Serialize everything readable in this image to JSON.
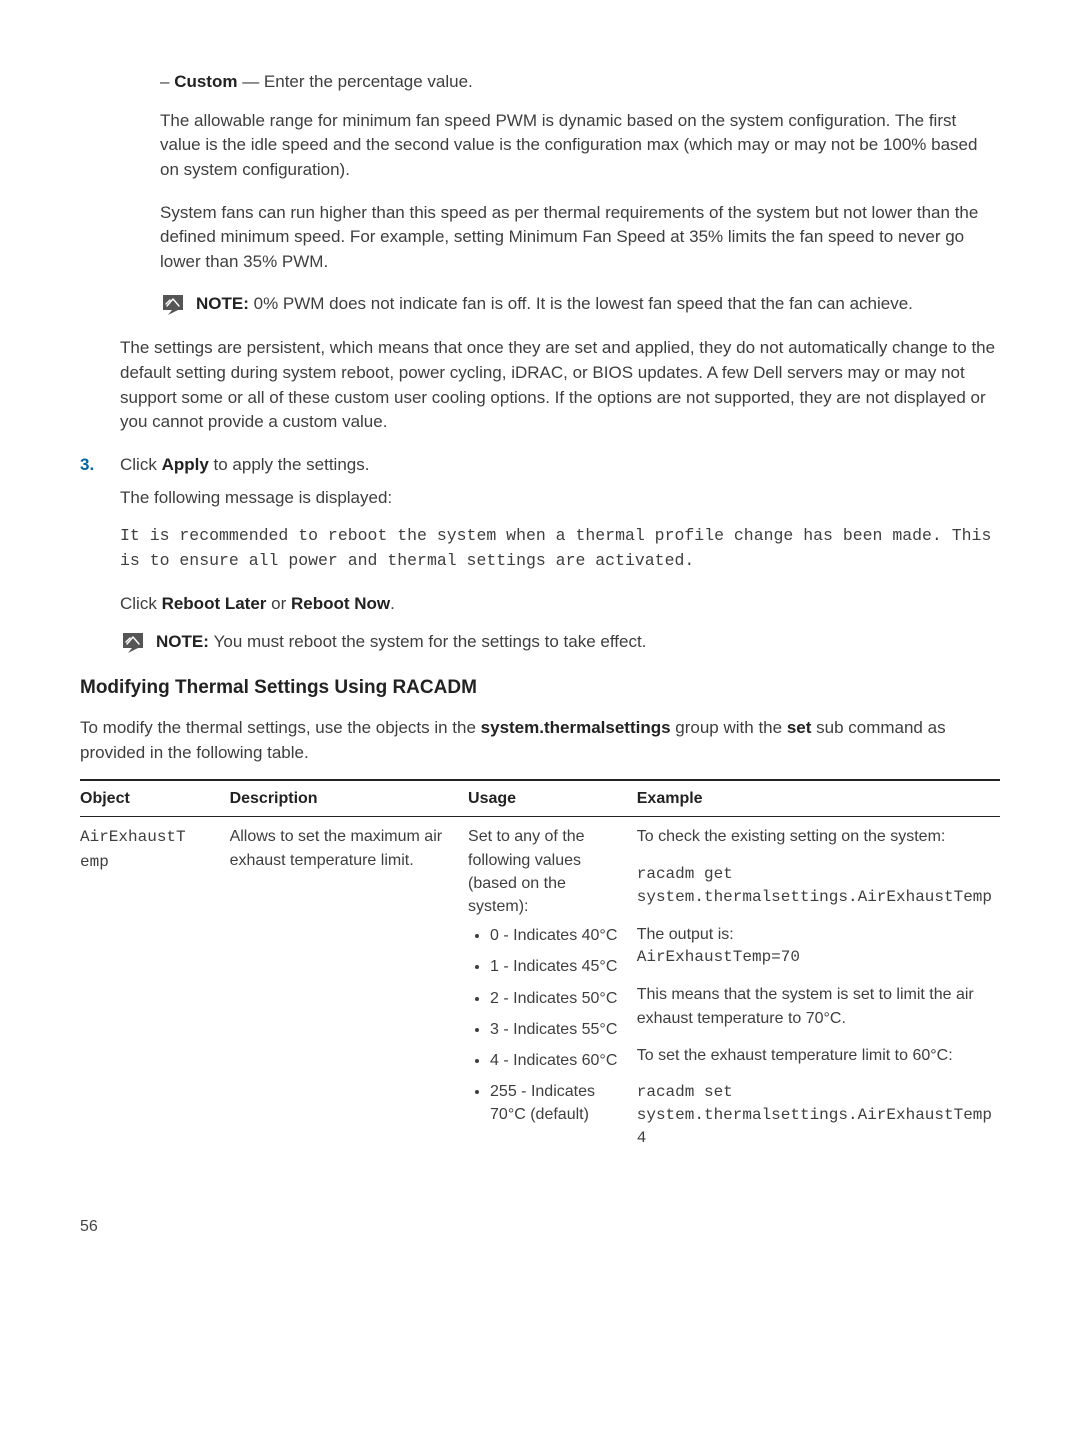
{
  "custom": {
    "label": "Custom",
    "desc": " — Enter the percentage value."
  },
  "para1": "The allowable range for minimum fan speed PWM is dynamic based on the system configuration. The first value is the idle speed and the second value is the configuration max (which may or may not be 100% based on system configuration).",
  "para2": "System fans can run higher than this speed as per thermal requirements of the system but not lower than the defined minimum speed. For example, setting Minimum Fan Speed at 35% limits the fan speed to never go lower than 35% PWM.",
  "note1": {
    "prefix": "NOTE: ",
    "text": "0% PWM does not indicate fan is off. It is the lowest fan speed that the fan can achieve."
  },
  "para3": "The settings are persistent, which means that once they are set and applied, they do not automatically change to the default setting during system reboot, power cycling, iDRAC, or BIOS updates. A few Dell servers may or may not support some or all of these custom user cooling options. If the options are not supported, they are not displayed or you cannot provide a custom value.",
  "step3": {
    "num": "3.",
    "text_a": "Click ",
    "apply": "Apply",
    "text_b": " to apply the settings.",
    "follow": "The following message is displayed:"
  },
  "codeblock": "It is recommended to reboot the system when a thermal profile change has been made. This is to ensure all power and thermal settings are activated.",
  "click_reboot": {
    "a": "Click ",
    "b": "Reboot Later",
    "c": " or ",
    "d": "Reboot Now",
    "e": "."
  },
  "note2": {
    "prefix": "NOTE: ",
    "text": "You must reboot the system for the settings to take effect."
  },
  "section_title": "Modifying Thermal Settings Using RACADM",
  "section_para": {
    "a": "To modify the thermal settings, use the objects in the ",
    "b": "system.thermalsettings",
    "c": " group with the ",
    "d": "set",
    "e": " sub command as provided in the following table."
  },
  "table": {
    "headers": {
      "object": "Object",
      "description": "Description",
      "usage": "Usage",
      "example": "Example"
    },
    "row": {
      "object": "AirExhaustT\nemp",
      "description": "Allows to set the maximum air exhaust temperature limit.",
      "usage_intro": "Set to any of the following values (based on the system):",
      "usage_items": [
        "0 - Indicates 40°C",
        "1 - Indicates 45°C",
        "2 - Indicates 50°C",
        "3 - Indicates 55°C",
        "4 - Indicates 60°C",
        "255 - Indicates 70°C (default)"
      ],
      "example": {
        "p1": "To check the existing setting on the system:",
        "code1": "racadm get system.thermalsettings.AirExhaustTemp",
        "p2": "The output is:",
        "code2": "AirExhaustTemp=70",
        "p3": "This means that the system is set to limit the air exhaust temperature to 70°C.",
        "p4": "To set the exhaust temperature limit to 60°C:",
        "code3": "racadm set system.thermalsettings.AirExhaustTemp 4"
      }
    }
  },
  "page_number": "56"
}
